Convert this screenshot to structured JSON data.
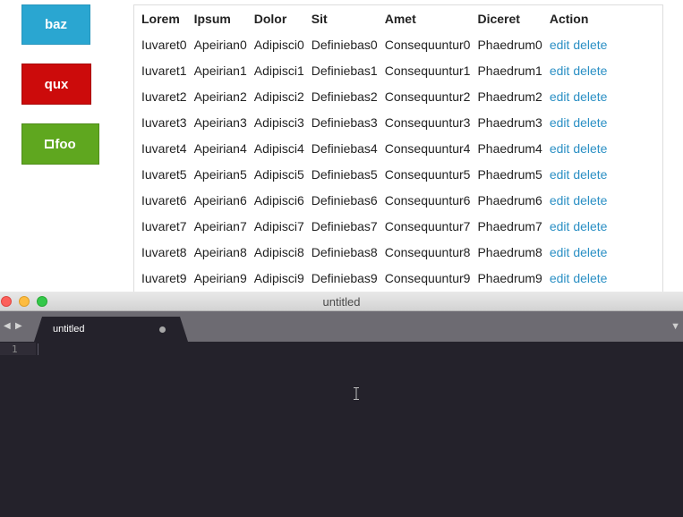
{
  "buttons": {
    "baz": "baz",
    "qux": "qux",
    "foo": "foo"
  },
  "table": {
    "headers": [
      "Lorem",
      "Ipsum",
      "Dolor",
      "Sit",
      "Amet",
      "Diceret",
      "Action"
    ],
    "rows": [
      [
        "Iuvaret0",
        "Apeirian0",
        "Adipisci0",
        "Definiebas0",
        "Consequuntur0",
        "Phaedrum0"
      ],
      [
        "Iuvaret1",
        "Apeirian1",
        "Adipisci1",
        "Definiebas1",
        "Consequuntur1",
        "Phaedrum1"
      ],
      [
        "Iuvaret2",
        "Apeirian2",
        "Adipisci2",
        "Definiebas2",
        "Consequuntur2",
        "Phaedrum2"
      ],
      [
        "Iuvaret3",
        "Apeirian3",
        "Adipisci3",
        "Definiebas3",
        "Consequuntur3",
        "Phaedrum3"
      ],
      [
        "Iuvaret4",
        "Apeirian4",
        "Adipisci4",
        "Definiebas4",
        "Consequuntur4",
        "Phaedrum4"
      ],
      [
        "Iuvaret5",
        "Apeirian5",
        "Adipisci5",
        "Definiebas5",
        "Consequuntur5",
        "Phaedrum5"
      ],
      [
        "Iuvaret6",
        "Apeirian6",
        "Adipisci6",
        "Definiebas6",
        "Consequuntur6",
        "Phaedrum6"
      ],
      [
        "Iuvaret7",
        "Apeirian7",
        "Adipisci7",
        "Definiebas7",
        "Consequuntur7",
        "Phaedrum7"
      ],
      [
        "Iuvaret8",
        "Apeirian8",
        "Adipisci8",
        "Definiebas8",
        "Consequuntur8",
        "Phaedrum8"
      ],
      [
        "Iuvaret9",
        "Apeirian9",
        "Adipisci9",
        "Definiebas9",
        "Consequuntur9",
        "Phaedrum9"
      ]
    ],
    "action_edit": "edit",
    "action_delete": "delete"
  },
  "editor": {
    "window_title": "untitled",
    "tab_label": "untitled",
    "line_number": "1"
  },
  "colors": {
    "baz": "#2aa6d1",
    "qux": "#cc0b0b",
    "foo": "#5fa71f",
    "link": "#2a8fc4",
    "editor_bg": "#24222b"
  },
  "icons": {
    "foo_prefix": "checkbox-icon",
    "nav_left": "triangle-left-icon",
    "nav_right": "triangle-right-icon",
    "tab_dirty": "dot-icon",
    "tab_menu": "triangle-down-icon",
    "cursor": "i-beam-icon"
  }
}
